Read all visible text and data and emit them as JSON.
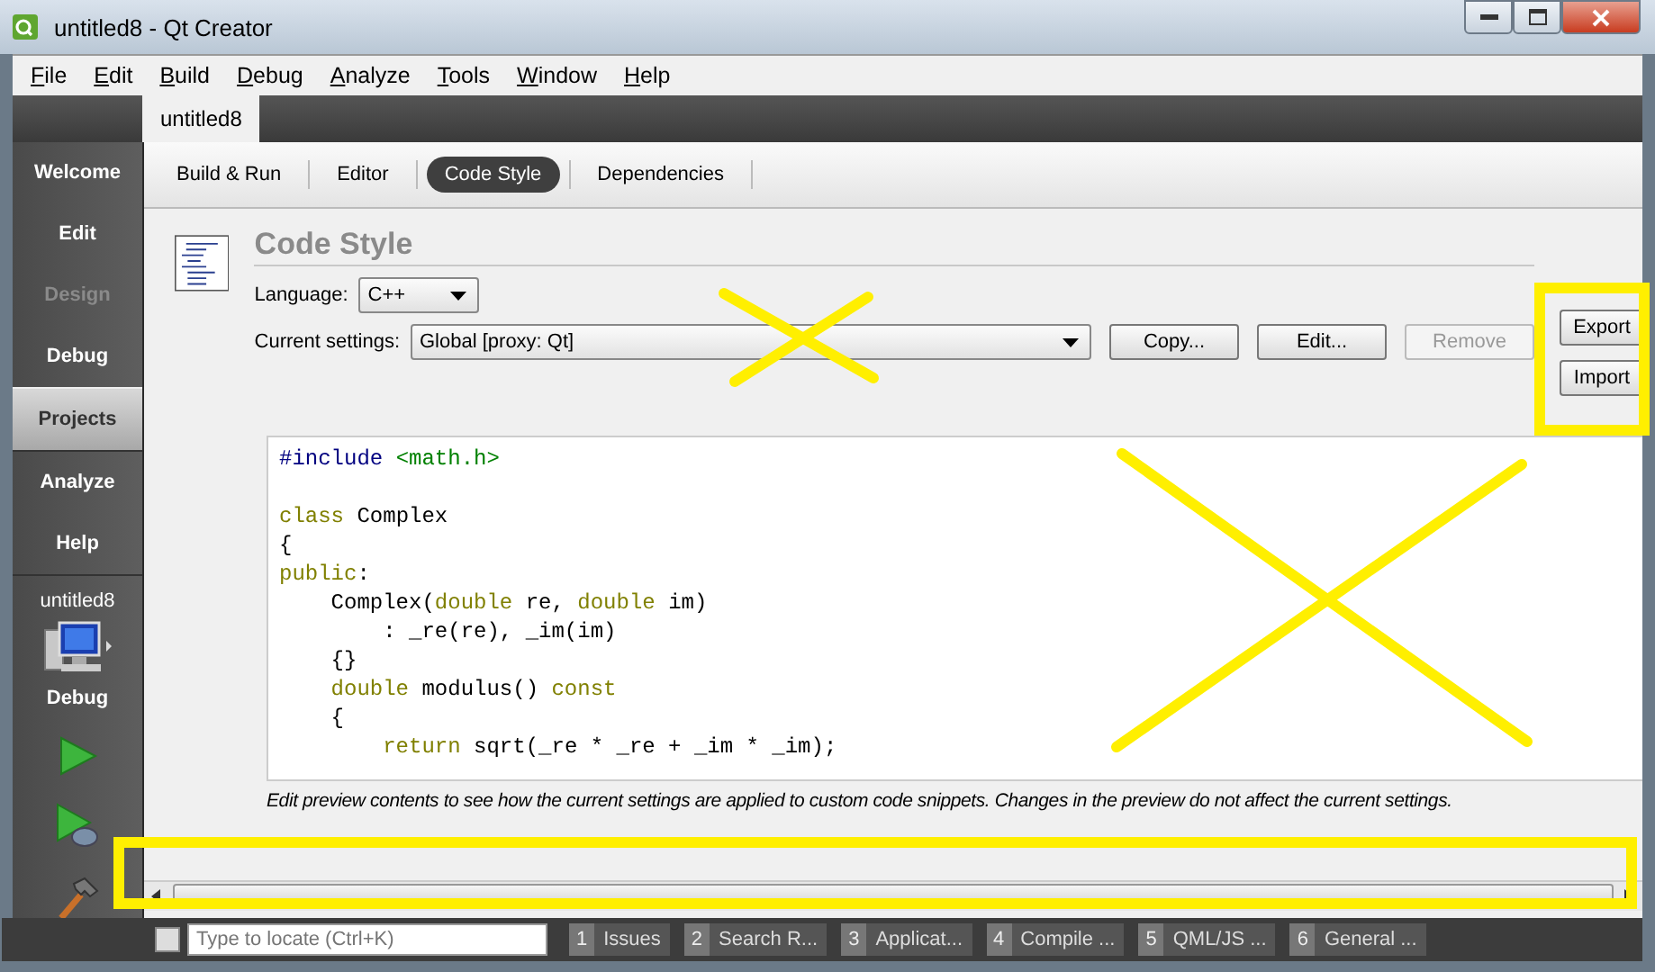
{
  "window": {
    "title": "untitled8 - Qt Creator"
  },
  "menu": [
    "File",
    "Edit",
    "Build",
    "Debug",
    "Analyze",
    "Tools",
    "Window",
    "Help"
  ],
  "project_tabs": [
    {
      "label": "untitled8",
      "selected": true
    }
  ],
  "modes": [
    {
      "label": "Welcome",
      "selected": false,
      "disabled": false
    },
    {
      "label": "Edit",
      "selected": false,
      "disabled": false
    },
    {
      "label": "Design",
      "selected": false,
      "disabled": true
    },
    {
      "label": "Debug",
      "selected": false,
      "disabled": false
    },
    {
      "label": "Projects",
      "selected": true,
      "disabled": false
    },
    {
      "label": "Analyze",
      "selected": false,
      "disabled": false
    },
    {
      "label": "Help",
      "selected": false,
      "disabled": false
    }
  ],
  "target": {
    "project": "untitled8",
    "build": "Debug"
  },
  "settings_tabs": [
    {
      "label": "Build & Run",
      "selected": false
    },
    {
      "label": "Editor",
      "selected": false
    },
    {
      "label": "Code Style",
      "selected": true
    },
    {
      "label": "Dependencies",
      "selected": false
    }
  ],
  "code_style": {
    "title": "Code Style",
    "language_label": "Language:",
    "language": "C++",
    "settings_label": "Current settings:",
    "settings": "Global [proxy: Qt]",
    "buttons": [
      {
        "label": "Copy...",
        "disabled": false
      },
      {
        "label": "Edit...",
        "disabled": false
      },
      {
        "label": "Remove",
        "disabled": true
      }
    ],
    "side_buttons": [
      {
        "label": "Export",
        "disabled": false
      },
      {
        "label": "Import",
        "disabled": false
      }
    ],
    "preview_blocks": [
      {
        "lines": [
          [
            {
              "kind": "preproc",
              "text": "#include "
            },
            {
              "kind": "string",
              "text": "<math.h>"
            }
          ]
        ]
      },
      {
        "lines": [
          [
            {
              "kind": "keyword",
              "text": "class"
            },
            {
              "kind": "plain",
              "text": " Complex"
            }
          ],
          [
            {
              "kind": "plain",
              "text": "{"
            }
          ],
          [
            {
              "kind": "keyword",
              "text": "public"
            },
            {
              "kind": "plain",
              "text": ":"
            }
          ],
          [
            {
              "kind": "plain",
              "text": "    Complex("
            },
            {
              "kind": "keyword",
              "text": "double"
            },
            {
              "kind": "plain",
              "text": " re, "
            },
            {
              "kind": "keyword",
              "text": "double"
            },
            {
              "kind": "plain",
              "text": " im)"
            }
          ],
          [
            {
              "kind": "plain",
              "text": "        : _re(re), _im(im)"
            }
          ],
          [
            {
              "kind": "plain",
              "text": "    {}"
            }
          ],
          [
            {
              "kind": "keyword",
              "text": "    double"
            },
            {
              "kind": "plain",
              "text": " modulus() "
            },
            {
              "kind": "keyword",
              "text": "const"
            }
          ],
          [
            {
              "kind": "plain",
              "text": "    {"
            }
          ],
          [
            {
              "kind": "keyword",
              "text": "        return"
            },
            {
              "kind": "plain",
              "text": " sqrt(_re * _re + _im * _im);"
            }
          ]
        ]
      }
    ],
    "hint": "Edit preview contents to see how the current settings are applied to custom code snippets. Changes in the preview do not affect the current settings."
  },
  "status_bar": {
    "placeholder": "Type to locate (Ctrl+K)",
    "panes": [
      {
        "number": "1",
        "label": "Issues"
      },
      {
        "number": "2",
        "label": "Search R..."
      },
      {
        "number": "3",
        "label": "Applicat..."
      },
      {
        "number": "4",
        "label": "Compile ..."
      },
      {
        "number": "5",
        "label": "QML/JS ..."
      },
      {
        "number": "6",
        "label": "General ..."
      }
    ]
  }
}
